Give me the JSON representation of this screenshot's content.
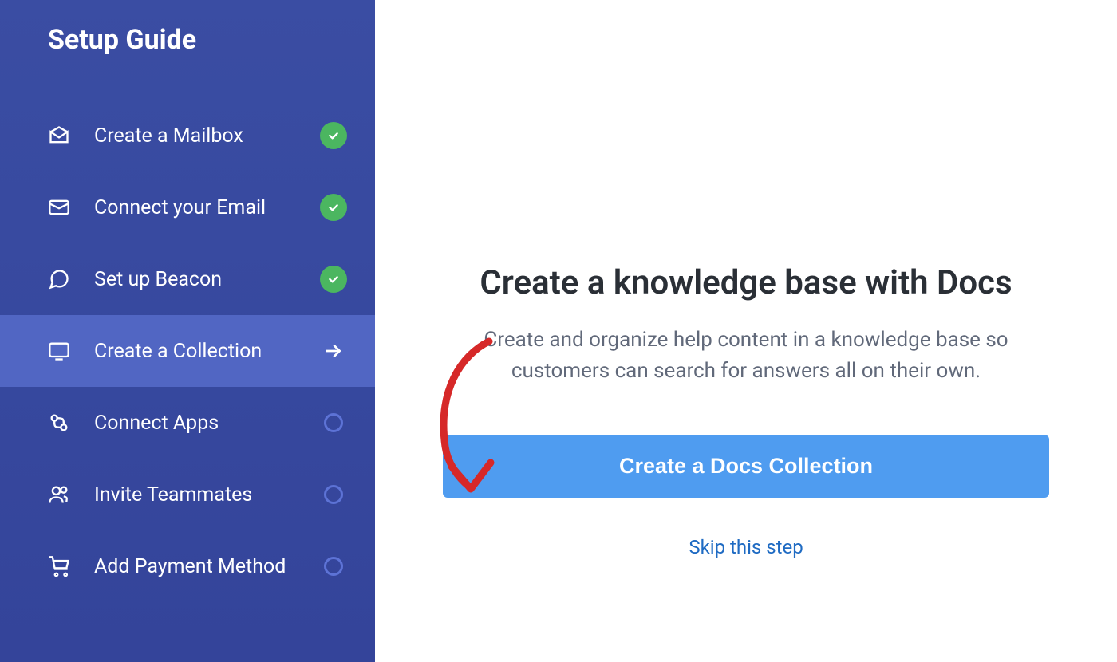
{
  "sidebar": {
    "title": "Setup Guide",
    "steps": [
      {
        "label": "Create a Mailbox",
        "icon": "mailbox",
        "status": "done"
      },
      {
        "label": "Connect your Email",
        "icon": "envelope",
        "status": "done"
      },
      {
        "label": "Set up Beacon",
        "icon": "chat",
        "status": "done"
      },
      {
        "label": "Create a Collection",
        "icon": "monitor",
        "status": "active"
      },
      {
        "label": "Connect Apps",
        "icon": "apps",
        "status": "pending"
      },
      {
        "label": "Invite Teammates",
        "icon": "users",
        "status": "pending"
      },
      {
        "label": "Add Payment Method",
        "icon": "cart",
        "status": "pending"
      }
    ]
  },
  "main": {
    "title": "Create a knowledge base with Docs",
    "description": "Create and organize help content in a knowledge base so customers can search for answers all on their own.",
    "cta_label": "Create a Docs Collection",
    "skip_label": "Skip this step"
  }
}
